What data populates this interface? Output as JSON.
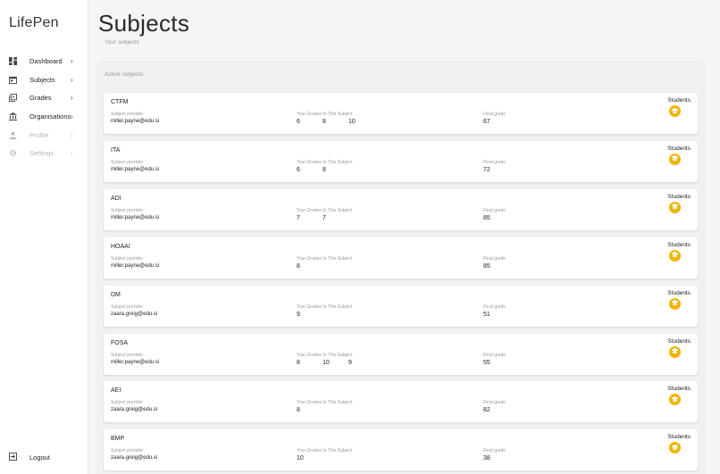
{
  "app": {
    "name": "LifePen"
  },
  "nav": [
    {
      "label": "Dashboard",
      "icon": "dashboard-icon",
      "disabled": false
    },
    {
      "label": "Subjects",
      "icon": "calendar-icon",
      "disabled": false
    },
    {
      "label": "Grades",
      "icon": "grades-icon",
      "disabled": false
    },
    {
      "label": "Organisations",
      "icon": "institution-icon",
      "disabled": false
    },
    {
      "label": "Profile",
      "icon": "person-icon",
      "disabled": true
    },
    {
      "label": "Settings",
      "icon": "gear-icon",
      "disabled": true
    }
  ],
  "logout": {
    "label": "Logout",
    "icon": "logout-icon"
  },
  "page": {
    "title": "Subjects",
    "subtitle": "Your subjects"
  },
  "panel": {
    "title": "Active subjects"
  },
  "labels": {
    "provider": "Subject provider",
    "grades": "Your Grades In This Subject",
    "final": "Final grade",
    "students": "Students"
  },
  "accent_color": "#f0b400",
  "subjects": [
    {
      "name": "CTFM",
      "provider": "miller.payne@edu.si",
      "grades": [
        "6",
        "8",
        "10"
      ],
      "final": "67"
    },
    {
      "name": "ITA",
      "provider": "miller.payne@edu.si",
      "grades": [
        "6",
        "8"
      ],
      "final": "72"
    },
    {
      "name": "ADI",
      "provider": "miller.payne@edu.si",
      "grades": [
        "7",
        "7"
      ],
      "final": "85"
    },
    {
      "name": "HOAAI",
      "provider": "miller.payne@edu.si",
      "grades": [
        "8"
      ],
      "final": "85"
    },
    {
      "name": "DM",
      "provider": "zaara.greig@edu.si",
      "grades": [
        "9"
      ],
      "final": "51"
    },
    {
      "name": "FOSA",
      "provider": "miller.payne@edu.si",
      "grades": [
        "8",
        "10",
        "9"
      ],
      "final": "55"
    },
    {
      "name": "AEI",
      "provider": "zaara.greig@edu.si",
      "grades": [
        "8"
      ],
      "final": "82"
    },
    {
      "name": "BMP",
      "provider": "zaara.greig@edu.si",
      "grades": [
        "10"
      ],
      "final": "38"
    }
  ]
}
